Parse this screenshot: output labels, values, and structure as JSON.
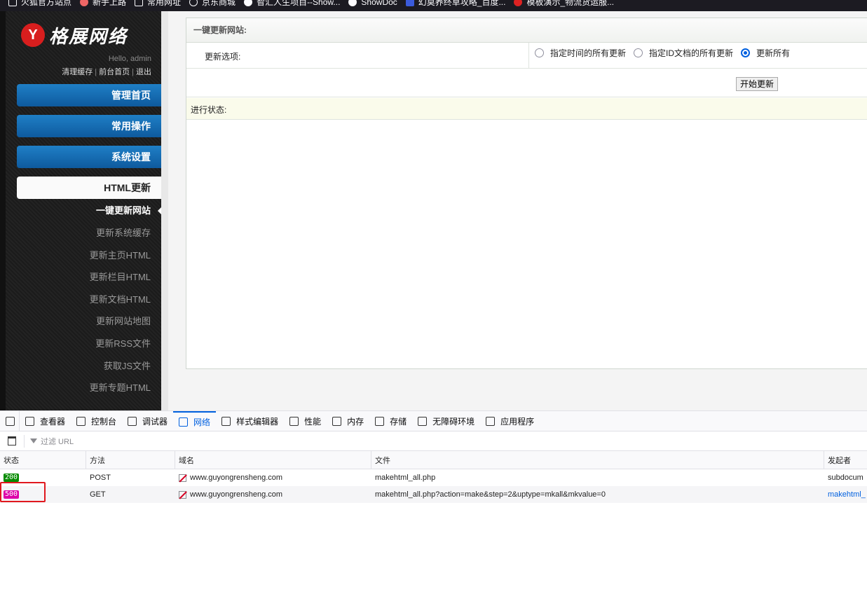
{
  "bookmarks": [
    {
      "label": "火狐官方站点",
      "icon": "folder-icon"
    },
    {
      "label": "新手上路",
      "icon": "firefox-icon"
    },
    {
      "label": "常用网址",
      "icon": "folder-icon"
    },
    {
      "label": "京东商城",
      "icon": "globe-icon"
    },
    {
      "label": "智汇人生项目--Show...",
      "icon": "showdoc-icon"
    },
    {
      "label": "ShowDoc",
      "icon": "showdoc-icon"
    },
    {
      "label": "幻莫养终草攻略_百度...",
      "icon": "baidu-icon"
    },
    {
      "label": "模板演示_物流货运服...",
      "icon": "y-icon"
    }
  ],
  "sidebar": {
    "logo_letter": "Y",
    "logo_name": "格展网络",
    "hello": "Hello, admin",
    "links": [
      "清理缓存",
      "前台首页",
      "退出"
    ],
    "menu": [
      "管理首页",
      "常用操作",
      "系统设置",
      "HTML更新"
    ],
    "sub_items": [
      "一键更新网站",
      "更新系统缓存",
      "更新主页HTML",
      "更新栏目HTML",
      "更新文档HTML",
      "更新网站地图",
      "更新RSS文件",
      "获取JS文件",
      "更新专题HTML"
    ]
  },
  "panel": {
    "title": "一键更新网站:",
    "option_label": "更新选项:",
    "options": [
      "指定时间的所有更新",
      "指定ID文档的所有更新",
      "更新所有"
    ],
    "selected_option": "更新所有",
    "start_button": "开始更新",
    "status_label": "进行状态:"
  },
  "devtools": {
    "tabs": [
      "查看器",
      "控制台",
      "调试器",
      "网络",
      "样式编辑器",
      "性能",
      "内存",
      "存储",
      "无障碍环境",
      "应用程序"
    ],
    "active_tab": "网络",
    "filter_placeholder": "过滤 URL",
    "columns": [
      "状态",
      "方法",
      "域名",
      "文件",
      "发起者"
    ],
    "requests": [
      {
        "status": "200",
        "method": "POST",
        "domain": "www.guyongrensheng.com",
        "file": "makehtml_all.php",
        "initiator": "subdocum"
      },
      {
        "status": "500",
        "method": "GET",
        "domain": "www.guyongrensheng.com",
        "file": "makehtml_all.php?action=make&step=2&uptype=mkall&mkvalue=0",
        "initiator": "makehtml_"
      }
    ],
    "colors": {
      "status_200": "#058b00",
      "status_500": "#dd00a9",
      "highlight": "#e0181e",
      "accent": "#0060df"
    }
  }
}
